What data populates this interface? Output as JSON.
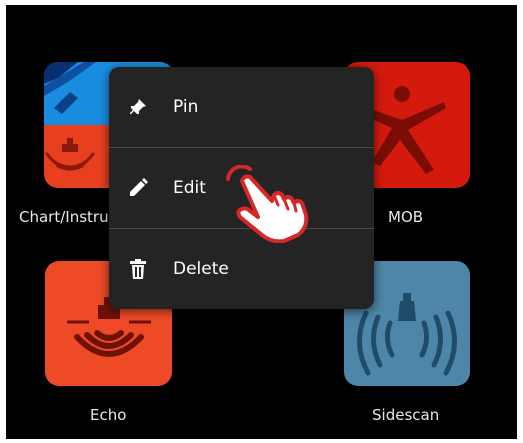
{
  "tiles": [
    {
      "id": "chart-instruments",
      "label": "Chart/Instruments"
    },
    {
      "id": "mob",
      "label": "MOB"
    },
    {
      "id": "echo",
      "label": "Echo"
    },
    {
      "id": "sidescan",
      "label": "Sidescan"
    }
  ],
  "context_menu": {
    "items": [
      {
        "label": "Pin",
        "icon": "pin-icon"
      },
      {
        "label": "Edit",
        "icon": "pencil-icon"
      },
      {
        "label": "Delete",
        "icon": "trash-icon"
      }
    ]
  },
  "colors": {
    "chart_top": "#1a8ce0",
    "chart_bottom": "#e8401f",
    "mob_tile": "#d41a0d",
    "echo_tile": "#ef4a26",
    "sidescan_tile": "#4d86a8",
    "menu_bg": "#242424",
    "tap_hand": "#d62828"
  }
}
